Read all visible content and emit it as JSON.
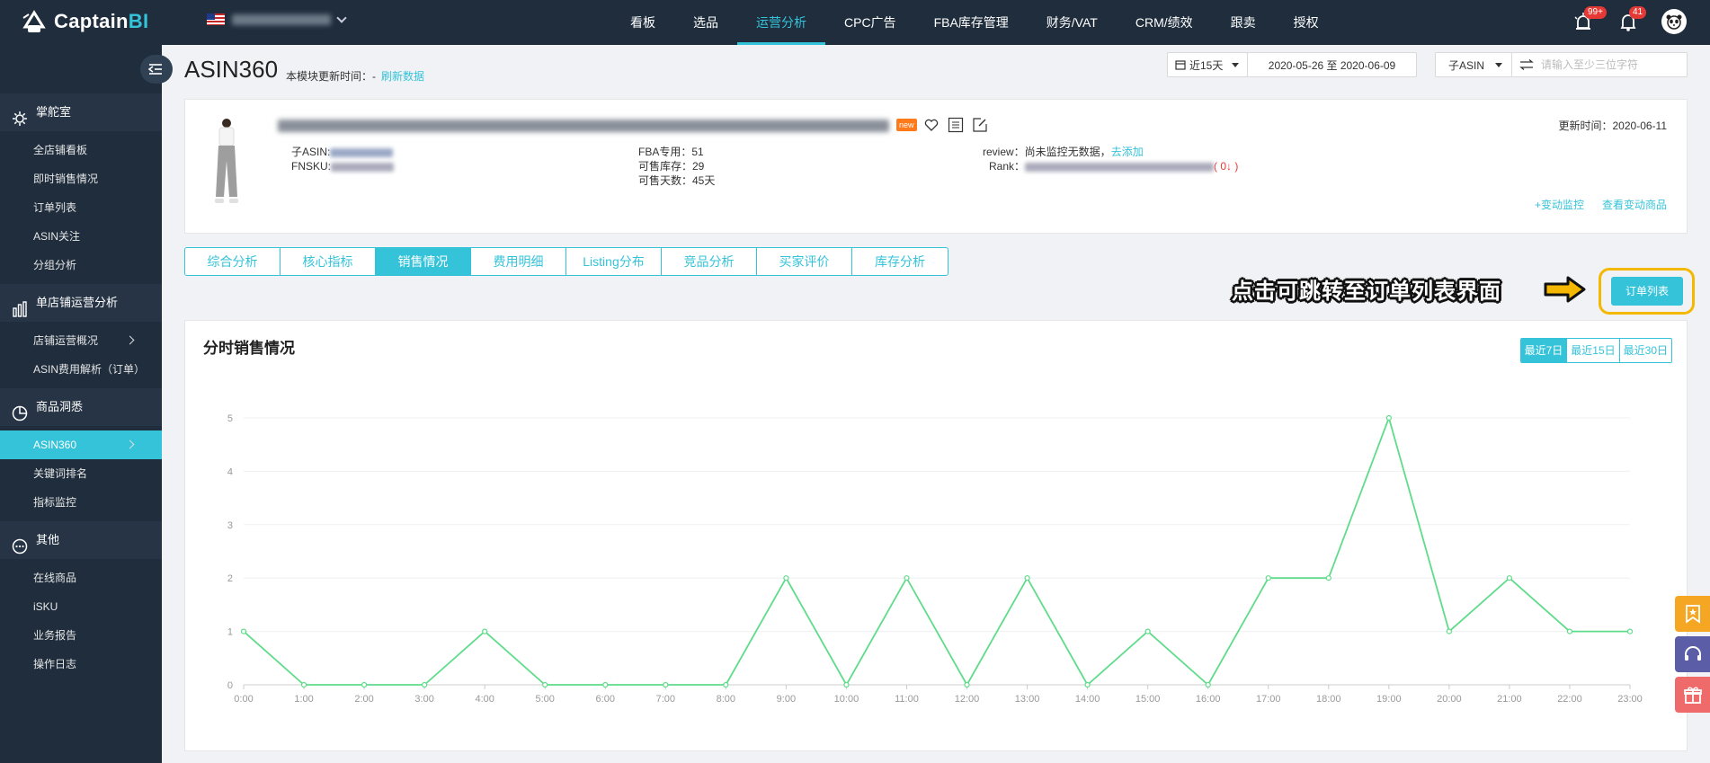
{
  "app": {
    "logo_prefix": "Captain",
    "logo_suffix": "BI"
  },
  "nav": [
    {
      "label": "看板",
      "active": false
    },
    {
      "label": "选品",
      "active": false
    },
    {
      "label": "运营分析",
      "active": true
    },
    {
      "label": "CPC广告",
      "active": false
    },
    {
      "label": "FBA库存管理",
      "active": false
    },
    {
      "label": "财务/VAT",
      "active": false
    },
    {
      "label": "CRM/绩效",
      "active": false
    },
    {
      "label": "跟卖",
      "active": false
    },
    {
      "label": "授权",
      "active": false
    }
  ],
  "top_icons": {
    "alert_badge": "99+",
    "bell_badge": "41"
  },
  "sidebar": {
    "groups": [
      {
        "label": "掌舵室",
        "icon": "gear-icon",
        "items": [
          {
            "label": "全店铺看板"
          },
          {
            "label": "即时销售情况"
          },
          {
            "label": "订单列表"
          },
          {
            "label": "ASIN关注"
          },
          {
            "label": "分组分析"
          }
        ]
      },
      {
        "label": "单店铺运营分析",
        "icon": "bar-chart-icon",
        "items": [
          {
            "label": "店铺运营概况",
            "has_arrow": true
          },
          {
            "label": "ASIN费用解析（订单）"
          }
        ]
      },
      {
        "label": "商品洞悉",
        "icon": "pie-chart-icon",
        "items": [
          {
            "label": "ASIN360",
            "active": true,
            "has_arrow": true
          },
          {
            "label": "关键词排名"
          },
          {
            "label": "指标监控"
          }
        ]
      },
      {
        "label": "其他",
        "icon": "more-icon",
        "items": [
          {
            "label": "在线商品"
          },
          {
            "label": "iSKU"
          },
          {
            "label": "业务报告"
          },
          {
            "label": "操作日志"
          }
        ]
      }
    ]
  },
  "header": {
    "title": "ASIN360",
    "update_label": "本模块更新时间：-",
    "refresh_label": "刷新数据",
    "range_select": "近15天",
    "date_range": "2020-05-26 至 2020-06-09",
    "asin_select": "子ASIN",
    "search_placeholder": "请输入至少三位字符"
  },
  "product": {
    "new_tag": "new",
    "child_asin_label": "子ASIN:",
    "fnsku_label": "FNSKU:",
    "fba_label": "FBA专用：51",
    "sellable_label": "可售库存：29",
    "days_label": "可售天数：45天",
    "review_label": "review：尚未监控无数据，",
    "review_link": "去添加",
    "rank_label": "Rank：",
    "rank_change": "( 0↓ )",
    "update_time": "更新时间：2020-06-11",
    "add_monitor": "+变动监控",
    "view_changes": "查看变动商品"
  },
  "tabs": [
    {
      "label": "综合分析",
      "active": false
    },
    {
      "label": "核心指标",
      "active": false
    },
    {
      "label": "销售情况",
      "active": true
    },
    {
      "label": "费用明细",
      "active": false
    },
    {
      "label": "Listing分布",
      "active": false
    },
    {
      "label": "竞品分析",
      "active": false
    },
    {
      "label": "买家评价",
      "active": false
    },
    {
      "label": "库存分析",
      "active": false
    }
  ],
  "callout": {
    "text": "点击可跳转至订单列表界面",
    "button_label": "订单列表"
  },
  "chart_section": {
    "title": "分时销售情况",
    "ranges": [
      {
        "label": "最近7日",
        "active": true
      },
      {
        "label": "最近15日",
        "active": false
      },
      {
        "label": "最近30日",
        "active": false
      }
    ]
  },
  "colors": {
    "accent": "#35c3d9",
    "line": "#5fdc8a",
    "nav_bg": "#1f2d3d",
    "highlight": "#f5b800"
  },
  "chart_data": {
    "type": "line",
    "title": "",
    "xlabel": "",
    "ylabel": "",
    "categories": [
      "0:00",
      "1:00",
      "2:00",
      "3:00",
      "4:00",
      "5:00",
      "6:00",
      "7:00",
      "8:00",
      "9:00",
      "10:00",
      "11:00",
      "12:00",
      "13:00",
      "14:00",
      "15:00",
      "16:00",
      "17:00",
      "18:00",
      "19:00",
      "20:00",
      "21:00",
      "22:00",
      "23:00"
    ],
    "values": [
      1,
      0,
      0,
      0,
      1,
      0,
      0,
      0,
      0,
      2,
      0,
      2,
      0,
      2,
      0,
      1,
      0,
      2,
      2,
      5,
      1,
      2,
      1,
      1
    ],
    "y_ticks": [
      0,
      1,
      2,
      3,
      4,
      5
    ],
    "ylim": [
      0,
      5
    ],
    "grid": true,
    "legend": "none"
  }
}
